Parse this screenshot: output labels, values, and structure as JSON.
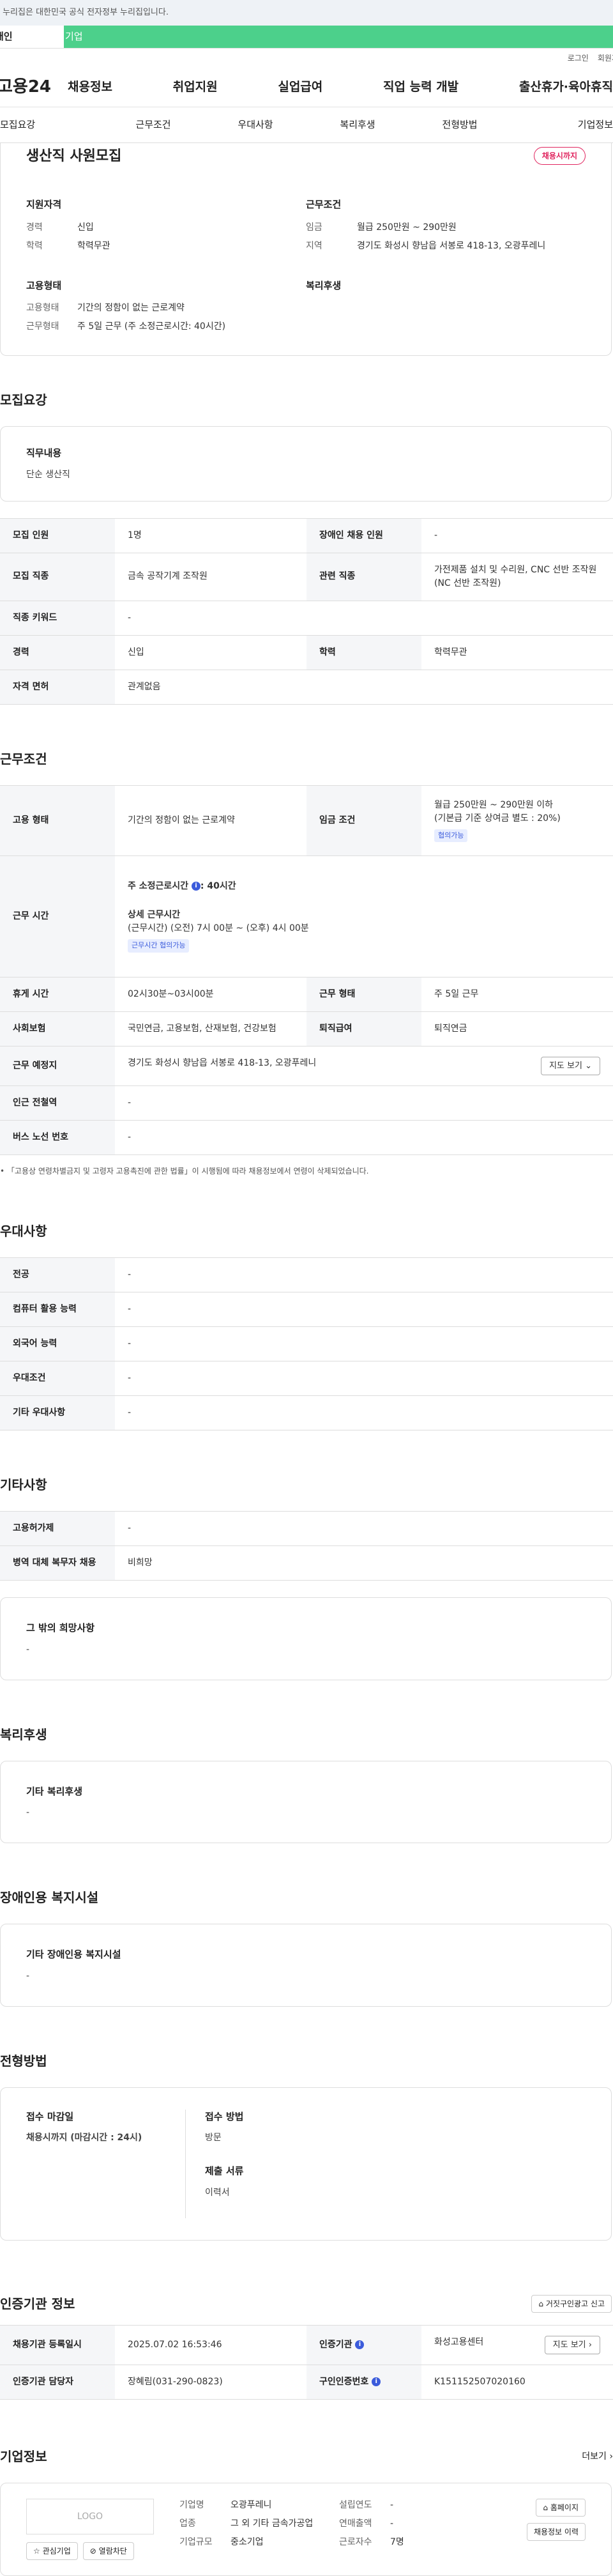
{
  "top": {
    "notice": "이 누리집은 대한민국 공식 전자정부 누리집입니다."
  },
  "typebar": {
    "personal": "개인",
    "enterprise": "기업"
  },
  "util": {
    "login": "로그인",
    "signup": "회원가입"
  },
  "gnb": {
    "logo": "고용24",
    "menu": [
      "채용정보",
      "취업지원",
      "실업급여",
      "직업 능력 개발",
      "출산휴가·육아휴직"
    ]
  },
  "tabs": [
    "모집요강",
    "근무조건",
    "우대사항",
    "복리후생",
    "전형방법",
    "기업정보"
  ],
  "summary": {
    "title": "생산직 사원모집",
    "badge": "채용시까지",
    "qual_title": "지원자격",
    "qual": [
      {
        "k": "경력",
        "v": "신입"
      },
      {
        "k": "학력",
        "v": "학력무관"
      }
    ],
    "cond_title": "근무조건",
    "cond": [
      {
        "k": "임금",
        "v": "월급 250만원 ~ 290만원"
      },
      {
        "k": "지역",
        "v": "경기도 화성시 향남읍 서봉로 418-13, 오광푸레니"
      }
    ],
    "emp_title": "고용형태",
    "emp": [
      {
        "k": "고용형태",
        "v": "기간의 정함이 없는 근로계약"
      },
      {
        "k": "근무형태",
        "v": "주 5일 근무 (주 소정근로시간: 40시간)"
      }
    ],
    "welfare_title": "복리후생"
  },
  "recruit": {
    "title": "모집요강",
    "duty_label": "직무내용",
    "duty": "단순 생산직",
    "rows": [
      {
        "k1": "모집 인원",
        "v1": "1명",
        "k2": "장애인 채용 인원",
        "v2": "-"
      },
      {
        "k1": "모집 직종",
        "v1": "금속 공작기계 조작원",
        "k2": "관련 직종",
        "v2": "가전제품 설치 및 수리원, CNC 선반 조작원(NC 선반 조작원)"
      },
      {
        "k1": "직종 키워드",
        "v1": "-"
      },
      {
        "k1": "경력",
        "v1": "신입",
        "k2": "학력",
        "v2": "학력무관"
      },
      {
        "k1": "자격 면허",
        "v1": "관계없음"
      }
    ]
  },
  "work": {
    "title": "근무조건",
    "emp_k": "고용 형태",
    "emp_v": "기간의 정함이 없는 근로계약",
    "wage_k": "임금 조건",
    "wage_v1": "월급 250만원 ~ 290만원 이하",
    "wage_v2": "(기본급 기준 상여금 별도 : 20%)",
    "wage_tag": "협의가능",
    "time_k": "근무 시간",
    "time_week": "주 소정근로시간",
    "time_week_v": ": 40시간",
    "time_detail_label": "상세 근무시간",
    "time_detail": "(근무시간) (오전) 7시 00분 ~ (오후) 4시 00분",
    "time_tag": "근무시간 협의가능",
    "break_k": "휴게 시간",
    "break_v": "02시30분~03시00분",
    "shape_k": "근무 형태",
    "shape_v": "주 5일 근무",
    "ins_k": "사회보험",
    "ins_v": "국민연금, 고용보험, 산재보험, 건강보험",
    "ret_k": "퇴직급여",
    "ret_v": "퇴직연금",
    "place_k": "근무 예정지",
    "place_v": "경기도 화성시 향남읍 서봉로 418-13, 오광푸레니",
    "map_btn": "지도 보기",
    "station_k": "인근 전철역",
    "station_v": "-",
    "bus_k": "버스 노선 번호",
    "bus_v": "-",
    "note": "「고용상 연령차별금지 및 고령자 고용촉진에 관한 법률」이 시행됨에 따라 채용정보에서 연령이 삭제되었습니다."
  },
  "pref": {
    "title": "우대사항",
    "rows": [
      {
        "k": "전공",
        "v": "-"
      },
      {
        "k": "컴퓨터 활용 능력",
        "v": "-"
      },
      {
        "k": "외국어 능력",
        "v": "-"
      },
      {
        "k": "우대조건",
        "v": "-"
      },
      {
        "k": "기타 우대사항",
        "v": "-"
      }
    ]
  },
  "etc": {
    "title": "기타사항",
    "rows": [
      {
        "k": "고용허가제",
        "v": "-"
      },
      {
        "k": "병역 대체 복무자 채용",
        "v": "비희망"
      }
    ],
    "wish_label": "그 밖의 희망사항",
    "wish": "-"
  },
  "welfare": {
    "title": "복리후생",
    "label": "기타 복리후생",
    "value": "-"
  },
  "disabled": {
    "title": "장애인용 복지시설",
    "label": "기타 장애인용 복지시설",
    "value": "-"
  },
  "select": {
    "title": "전형방법",
    "deadline_label": "접수 마감일",
    "deadline": "채용시까지 (마감시간 : 24시)",
    "method_label": "접수 방법",
    "method": "방문",
    "docs_label": "제출 서류",
    "docs": "이력서"
  },
  "cert": {
    "title": "인증기관 정보",
    "report_btn": "거짓구인광고 신고",
    "reg_k": "채용기관 등록일시",
    "reg_v": "2025.07.02 16:53:46",
    "org_k": "인증기관",
    "org_v": "화성고용센터",
    "map_btn": "지도 보기",
    "mgr_k": "인증기관 담당자",
    "mgr_v": "장혜림(031-290-0823)",
    "num_k": "구인인증번호",
    "num_v": "K151152507020160"
  },
  "company": {
    "title": "기업정보",
    "more": "더보기",
    "logo": "LOGO",
    "fav_btn": "관심기업",
    "block_btn": "열람차단",
    "name_k": "기업명",
    "name_v": "오광푸레니",
    "ind_k": "업종",
    "ind_v": "그 외 기타 금속가공업",
    "size_k": "기업규모",
    "size_v": "중소기업",
    "est_k": "설립연도",
    "est_v": "-",
    "sales_k": "연매출액",
    "sales_v": "-",
    "emp_k": "근로자수",
    "emp_v": "7명",
    "home_btn": "홈페이지",
    "history_btn": "채용정보 이력"
  }
}
